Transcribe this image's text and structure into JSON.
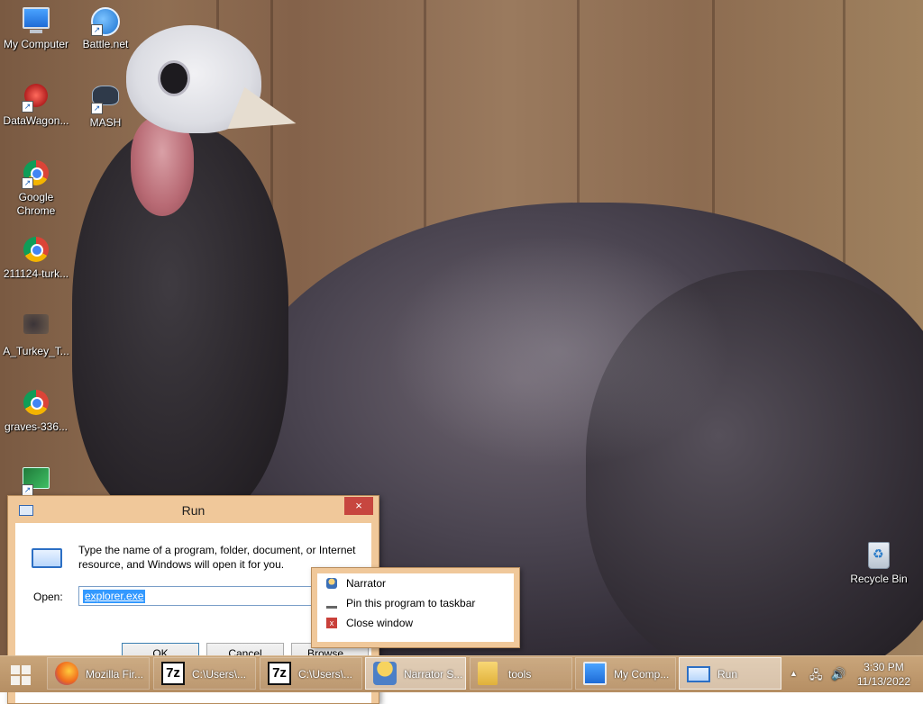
{
  "desktop": {
    "icons": [
      {
        "label": "My Computer",
        "icon": "computer-icon"
      },
      {
        "label": "Battle.net",
        "icon": "battlenet-icon"
      },
      {
        "label": "DataWagon...",
        "icon": "datawagon-icon"
      },
      {
        "label": "MASH",
        "icon": "mash-icon"
      },
      {
        "label": "Google Chrome",
        "icon": "chrome-icon"
      },
      {
        "label": "211124-turk...",
        "icon": "chrome-icon"
      },
      {
        "label": "A_Turkey_T...",
        "icon": "image-icon"
      },
      {
        "label": "graves-336...",
        "icon": "chrome-icon"
      },
      {
        "label": "",
        "icon": "program-icon"
      },
      {
        "label": "Recycle Bin",
        "icon": "recycle-bin-icon"
      }
    ]
  },
  "run_dialog": {
    "title": "Run",
    "close_label": "×",
    "description": "Type the name of a program, folder, document, or Internet resource, and Windows will open it for you.",
    "open_label": "Open:",
    "input_value": "explorer.exe",
    "buttons": {
      "ok": "OK",
      "cancel": "Cancel",
      "browse": "Browse..."
    }
  },
  "jump_list": {
    "items": [
      {
        "label": "Narrator",
        "icon": "narrator-icon"
      },
      {
        "label": "Pin this program to taskbar",
        "icon": "pin-icon"
      },
      {
        "label": "Close window",
        "icon": "close-icon"
      }
    ],
    "close_glyph": "x"
  },
  "taskbar": {
    "buttons": [
      {
        "label": "Mozilla Fir...",
        "icon": "firefox-icon"
      },
      {
        "label": "C:\\Users\\...",
        "icon": "7zip-icon"
      },
      {
        "label": "C:\\Users\\...",
        "icon": "7zip-icon"
      },
      {
        "label": "Narrator S...",
        "icon": "narrator-icon"
      },
      {
        "label": "tools",
        "icon": "folder-icon"
      },
      {
        "label": "My Comp...",
        "icon": "computer-icon"
      },
      {
        "label": "Run",
        "icon": "run-icon"
      }
    ],
    "sevenzip_glyph": "7z",
    "tray": {
      "show_hidden": "▲",
      "network": "🖧",
      "volume": "🔊"
    },
    "clock": {
      "time": "3:30 PM",
      "date": "11/13/2022"
    }
  },
  "colors": {
    "window_frame": "#f0c89a",
    "close_button": "#c7463f",
    "taskbar": "#c9a57a",
    "selection": "#3399ff"
  }
}
